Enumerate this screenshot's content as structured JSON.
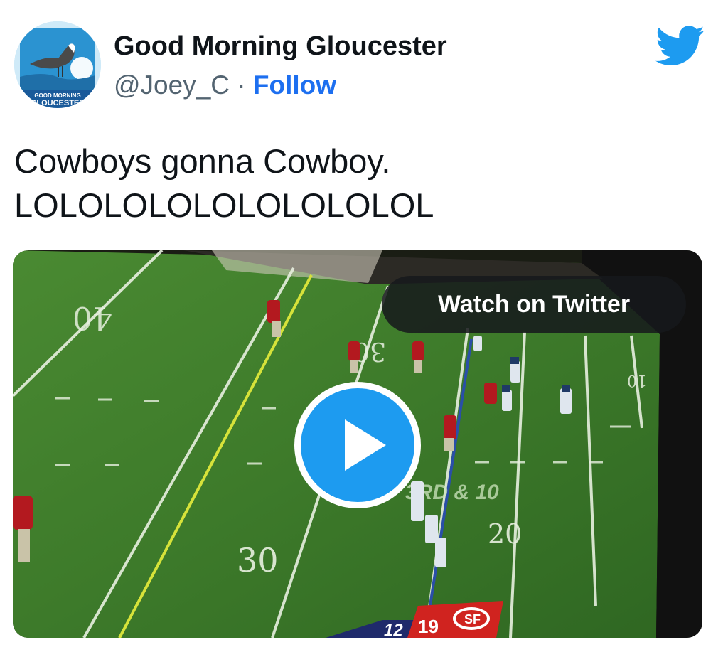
{
  "tweet": {
    "author": {
      "display_name": "Good Morning Gloucester",
      "handle": "@Joey_C",
      "separator": "·",
      "follow_label": "Follow",
      "avatar_text_top": "GOOD MORNING",
      "avatar_text_bottom": "GLOUCESTER"
    },
    "text_lines": [
      "Cowboys gonna Cowboy.",
      "LOLOLOLOLOLOLOLOLOL"
    ],
    "brand_icon": "twitter-bird-icon"
  },
  "media": {
    "watch_label": "Watch on Twitter",
    "play_icon": "play-icon",
    "field": {
      "yard_labels": [
        "40",
        "30",
        "30",
        "20",
        "10"
      ],
      "down_distance": "3RD & 10",
      "score_left": "12",
      "score_right": "19",
      "team_logo_text": "SF"
    }
  },
  "colors": {
    "accent": "#1d9bf0",
    "follow": "#1d6ff0",
    "field_green": "#3f7f2c",
    "niners_red": "#b3191f"
  }
}
